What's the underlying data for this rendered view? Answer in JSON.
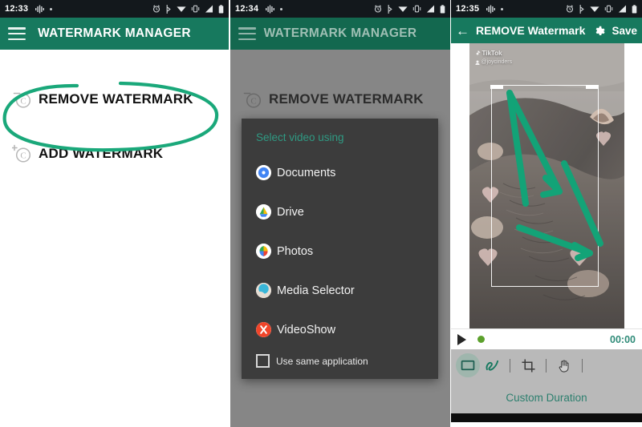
{
  "panels": [
    {
      "status": {
        "time": "12:33",
        "icons": [
          "equalizer-icon",
          "dot-icon",
          "alarm-icon",
          "bluetooth-icon",
          "wifi-icon",
          "vibrate-icon",
          "signal-icon",
          "battery-icon"
        ]
      },
      "appbar": {
        "menu_icon": "hamburger-icon",
        "title": "WATERMARK MANAGER"
      },
      "menu": [
        {
          "icon": "remove-copyright-icon",
          "label": "REMOVE WATERMARK"
        },
        {
          "icon": "add-copyright-icon",
          "label": "ADD WATERMARK"
        }
      ],
      "annotation": "green-ellipse-highlight"
    },
    {
      "status": {
        "time": "12:34"
      },
      "appbar": {
        "menu_icon": "hamburger-icon",
        "title": "WATERMARK MANAGER"
      },
      "background_menu": [
        {
          "icon": "remove-copyright-icon",
          "label": "REMOVE WATERMARK"
        },
        {
          "icon": "add-copyright-icon",
          "label": "ADD WATERMARK"
        }
      ],
      "dialog": {
        "title": "Select video using",
        "items": [
          {
            "icon": "documents-app-icon",
            "label": "Documents"
          },
          {
            "icon": "drive-app-icon",
            "label": "Drive"
          },
          {
            "icon": "photos-app-icon",
            "label": "Photos"
          },
          {
            "icon": "media-selector-app-icon",
            "label": "Media Selector"
          },
          {
            "icon": "videoshow-app-icon",
            "label": "VideoShow"
          }
        ],
        "checkbox": {
          "label": "Use same application",
          "checked": false
        }
      }
    },
    {
      "status": {
        "time": "12:35"
      },
      "appbar": {
        "back_icon": "back-arrow-icon",
        "title": "REMOVE Watermark",
        "settings_icon": "gear-icon",
        "save_label": "Save"
      },
      "video": {
        "watermark_brand": "TikTok",
        "watermark_user": "@joycinders",
        "selection": "watermark-selection-rectangle",
        "annotation": "green-arrows-highlight"
      },
      "playbar": {
        "play_icon": "play-icon",
        "record_icon": "record-dot-icon",
        "timecode": "00:00"
      },
      "toolbar": {
        "tools": [
          {
            "icon": "rectangle-tool-icon",
            "active": true
          },
          {
            "icon": "scribble-tool-icon",
            "active": false
          },
          {
            "icon": "crop-tool-icon",
            "active": false
          },
          {
            "icon": "hand-tool-icon",
            "active": false
          }
        ],
        "custom_duration_label": "Custom Duration"
      }
    }
  ],
  "colors": {
    "accent_teal": "#17795e",
    "annotation_green": "#1aa87a",
    "dialog_bg": "#3c3c3c",
    "dialog_title": "#2f9a83"
  }
}
